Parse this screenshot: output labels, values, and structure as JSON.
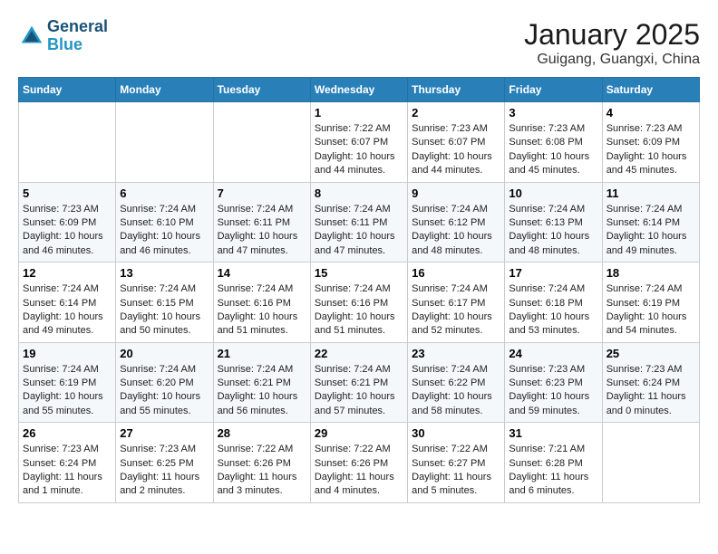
{
  "header": {
    "logo_line1": "General",
    "logo_line2": "Blue",
    "month": "January 2025",
    "location": "Guigang, Guangxi, China"
  },
  "days_of_week": [
    "Sunday",
    "Monday",
    "Tuesday",
    "Wednesday",
    "Thursday",
    "Friday",
    "Saturday"
  ],
  "weeks": [
    [
      {
        "day": "",
        "info": ""
      },
      {
        "day": "",
        "info": ""
      },
      {
        "day": "",
        "info": ""
      },
      {
        "day": "1",
        "info": "Sunrise: 7:22 AM\nSunset: 6:07 PM\nDaylight: 10 hours and 44 minutes."
      },
      {
        "day": "2",
        "info": "Sunrise: 7:23 AM\nSunset: 6:07 PM\nDaylight: 10 hours and 44 minutes."
      },
      {
        "day": "3",
        "info": "Sunrise: 7:23 AM\nSunset: 6:08 PM\nDaylight: 10 hours and 45 minutes."
      },
      {
        "day": "4",
        "info": "Sunrise: 7:23 AM\nSunset: 6:09 PM\nDaylight: 10 hours and 45 minutes."
      }
    ],
    [
      {
        "day": "5",
        "info": "Sunrise: 7:23 AM\nSunset: 6:09 PM\nDaylight: 10 hours and 46 minutes."
      },
      {
        "day": "6",
        "info": "Sunrise: 7:24 AM\nSunset: 6:10 PM\nDaylight: 10 hours and 46 minutes."
      },
      {
        "day": "7",
        "info": "Sunrise: 7:24 AM\nSunset: 6:11 PM\nDaylight: 10 hours and 47 minutes."
      },
      {
        "day": "8",
        "info": "Sunrise: 7:24 AM\nSunset: 6:11 PM\nDaylight: 10 hours and 47 minutes."
      },
      {
        "day": "9",
        "info": "Sunrise: 7:24 AM\nSunset: 6:12 PM\nDaylight: 10 hours and 48 minutes."
      },
      {
        "day": "10",
        "info": "Sunrise: 7:24 AM\nSunset: 6:13 PM\nDaylight: 10 hours and 48 minutes."
      },
      {
        "day": "11",
        "info": "Sunrise: 7:24 AM\nSunset: 6:14 PM\nDaylight: 10 hours and 49 minutes."
      }
    ],
    [
      {
        "day": "12",
        "info": "Sunrise: 7:24 AM\nSunset: 6:14 PM\nDaylight: 10 hours and 49 minutes."
      },
      {
        "day": "13",
        "info": "Sunrise: 7:24 AM\nSunset: 6:15 PM\nDaylight: 10 hours and 50 minutes."
      },
      {
        "day": "14",
        "info": "Sunrise: 7:24 AM\nSunset: 6:16 PM\nDaylight: 10 hours and 51 minutes."
      },
      {
        "day": "15",
        "info": "Sunrise: 7:24 AM\nSunset: 6:16 PM\nDaylight: 10 hours and 51 minutes."
      },
      {
        "day": "16",
        "info": "Sunrise: 7:24 AM\nSunset: 6:17 PM\nDaylight: 10 hours and 52 minutes."
      },
      {
        "day": "17",
        "info": "Sunrise: 7:24 AM\nSunset: 6:18 PM\nDaylight: 10 hours and 53 minutes."
      },
      {
        "day": "18",
        "info": "Sunrise: 7:24 AM\nSunset: 6:19 PM\nDaylight: 10 hours and 54 minutes."
      }
    ],
    [
      {
        "day": "19",
        "info": "Sunrise: 7:24 AM\nSunset: 6:19 PM\nDaylight: 10 hours and 55 minutes."
      },
      {
        "day": "20",
        "info": "Sunrise: 7:24 AM\nSunset: 6:20 PM\nDaylight: 10 hours and 55 minutes."
      },
      {
        "day": "21",
        "info": "Sunrise: 7:24 AM\nSunset: 6:21 PM\nDaylight: 10 hours and 56 minutes."
      },
      {
        "day": "22",
        "info": "Sunrise: 7:24 AM\nSunset: 6:21 PM\nDaylight: 10 hours and 57 minutes."
      },
      {
        "day": "23",
        "info": "Sunrise: 7:24 AM\nSunset: 6:22 PM\nDaylight: 10 hours and 58 minutes."
      },
      {
        "day": "24",
        "info": "Sunrise: 7:23 AM\nSunset: 6:23 PM\nDaylight: 10 hours and 59 minutes."
      },
      {
        "day": "25",
        "info": "Sunrise: 7:23 AM\nSunset: 6:24 PM\nDaylight: 11 hours and 0 minutes."
      }
    ],
    [
      {
        "day": "26",
        "info": "Sunrise: 7:23 AM\nSunset: 6:24 PM\nDaylight: 11 hours and 1 minute."
      },
      {
        "day": "27",
        "info": "Sunrise: 7:23 AM\nSunset: 6:25 PM\nDaylight: 11 hours and 2 minutes."
      },
      {
        "day": "28",
        "info": "Sunrise: 7:22 AM\nSunset: 6:26 PM\nDaylight: 11 hours and 3 minutes."
      },
      {
        "day": "29",
        "info": "Sunrise: 7:22 AM\nSunset: 6:26 PM\nDaylight: 11 hours and 4 minutes."
      },
      {
        "day": "30",
        "info": "Sunrise: 7:22 AM\nSunset: 6:27 PM\nDaylight: 11 hours and 5 minutes."
      },
      {
        "day": "31",
        "info": "Sunrise: 7:21 AM\nSunset: 6:28 PM\nDaylight: 11 hours and 6 minutes."
      },
      {
        "day": "",
        "info": ""
      }
    ]
  ]
}
